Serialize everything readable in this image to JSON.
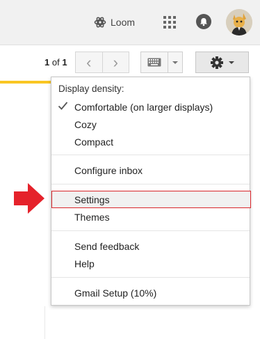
{
  "header": {
    "loom_label": "Loom",
    "icons": [
      "loom-icon",
      "apps-grid-icon",
      "bell-icon",
      "avatar"
    ]
  },
  "toolbar": {
    "pager_start": "1",
    "pager_of": " of ",
    "pager_total": "1",
    "prev_icon": "‹",
    "next_icon": "›",
    "icons": [
      "chevron-left-icon",
      "chevron-right-icon",
      "keyboard-icon",
      "caret-down-icon",
      "gear-icon"
    ]
  },
  "menu": {
    "heading": "Display density:",
    "density_options": [
      {
        "label": "Comfortable (on larger displays)",
        "checked": true
      },
      {
        "label": "Cozy",
        "checked": false
      },
      {
        "label": "Compact",
        "checked": false
      }
    ],
    "configure_inbox": "Configure inbox",
    "settings": "Settings",
    "themes": "Themes",
    "send_feedback": "Send feedback",
    "help": "Help",
    "gmail_setup": "Gmail Setup (10%)"
  },
  "colors": {
    "highlight_border": "#d9262b",
    "arrow": "#e5222b",
    "accent_strip": "#f9c623"
  }
}
